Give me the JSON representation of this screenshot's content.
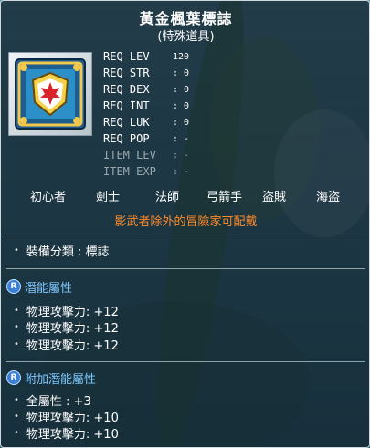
{
  "item": {
    "name": "黃金楓葉標誌",
    "type": "(特殊道具)",
    "icon": "gold-maple-emblem-icon"
  },
  "requirements": [
    {
      "label": "REQ LEV",
      "value": "120",
      "dim": false
    },
    {
      "label": "REQ STR",
      "value": ": 0",
      "dim": false
    },
    {
      "label": "REQ DEX",
      "value": ": 0",
      "dim": false
    },
    {
      "label": "REQ INT",
      "value": ": 0",
      "dim": false
    },
    {
      "label": "REQ LUK",
      "value": ": 0",
      "dim": false
    },
    {
      "label": "REQ POP",
      "value": ": -",
      "dim": false
    },
    {
      "label": "ITEM LEV",
      "value": ": -",
      "dim": true
    },
    {
      "label": "ITEM EXP",
      "value": ": -",
      "dim": true
    }
  ],
  "jobs": [
    "初心者",
    "劍士",
    "法師",
    "弓箭手",
    "盜賊",
    "海盜"
  ],
  "job_note": "影武者除外的冒險家可配戴",
  "equip_category": "裝備分類 : 標誌",
  "potential": {
    "badge": "R",
    "title": "潛能屬性",
    "lines": [
      "物理攻擊力: +12",
      "物理攻擊力: +12",
      "物理攻擊力: +12"
    ]
  },
  "bonus_potential": {
    "badge": "R",
    "title": "附加潛能屬性",
    "lines": [
      "全屬性 : +3",
      "物理攻擊力: +10",
      "物理攻擊力: +10"
    ]
  },
  "colors": {
    "job_note": "#ff8a2a",
    "section_title": "#7fc8ff",
    "badge": "#3b7fd6"
  }
}
